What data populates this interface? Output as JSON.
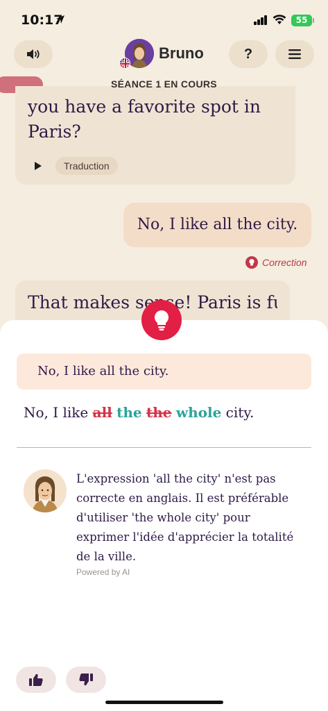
{
  "status_bar": {
    "time": "10:17",
    "battery": "55"
  },
  "header": {
    "tutor_name": "Bruno",
    "help_label": "?",
    "session_status": "SÉANCE 1 EN COURS",
    "icons": [
      "speaker-icon",
      "help-icon",
      "menu-icon",
      "uk-flag-icon"
    ]
  },
  "chat": {
    "bot_message_1": "you have a favorite spot in Paris?",
    "translate_label": "Traduction",
    "user_message_1": "No, I like all the city.",
    "correction_label": "Correction",
    "bot_message_2": "That makes sense! Paris is full"
  },
  "correction_sheet": {
    "original": "No, I like all the city.",
    "corrected": {
      "prefix": "No, I like",
      "removed_1": "all",
      "added_1": "the",
      "removed_2": "the",
      "added_2": "whole",
      "suffix": "city."
    },
    "explanation": "L'expression 'all the city' n'est pas correcte en anglais. Il est préférable d'utiliser 'the whole city' pour exprimer l'idée d'apprécier la totalité de la ville.",
    "powered_by": "Powered by AI"
  },
  "colors": {
    "accent_red": "#e21f44",
    "insert_teal": "#2aa39b",
    "delete_red": "#d3334a",
    "text_purple": "#2e1a47",
    "background": "#f5ede0"
  }
}
